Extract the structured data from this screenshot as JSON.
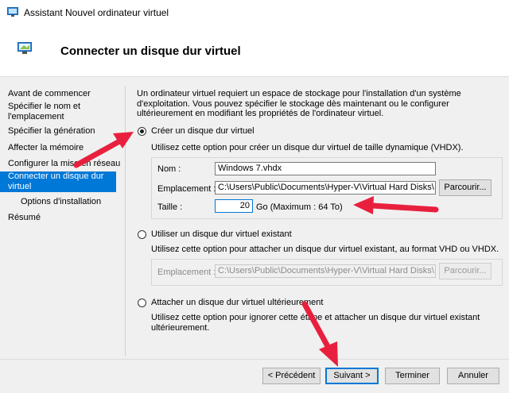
{
  "window": {
    "title": "Assistant Nouvel ordinateur virtuel"
  },
  "header": {
    "title": "Connecter un disque dur virtuel"
  },
  "nav": {
    "items": [
      {
        "label": "Avant de commencer"
      },
      {
        "label": "Spécifier le nom et l'emplacement"
      },
      {
        "label": "Spécifier la génération"
      },
      {
        "label": "Affecter la mémoire"
      },
      {
        "label": "Configurer la mise en réseau"
      },
      {
        "label": "Connecter un disque dur virtuel"
      },
      {
        "label": "Options d'installation"
      },
      {
        "label": "Résumé"
      }
    ],
    "active_index": 5
  },
  "intro": {
    "text": "Un ordinateur virtuel requiert un espace de stockage pour l'installation d'un système d'exploitation. Vous pouvez spécifier le stockage dès maintenant ou le configurer ultérieurement en modifiant les propriétés de l'ordinateur virtuel."
  },
  "option_create": {
    "label": "Créer un disque dur virtuel",
    "selected": true,
    "description": "Utilisez cette option pour créer un disque dur virtuel de taille dynamique (VHDX).",
    "name_label": "Nom :",
    "name_value": "Windows 7.vhdx",
    "location_label": "Emplacement :",
    "location_value": "C:\\Users\\Public\\Documents\\Hyper-V\\Virtual Hard Disks\\",
    "browse_label": "Parcourir...",
    "size_label": "Taille :",
    "size_value": "20",
    "size_unit": "Go (Maximum : 64 To)"
  },
  "option_existing": {
    "label": "Utiliser un disque dur virtuel existant",
    "selected": false,
    "description": "Utilisez cette option pour attacher un disque dur virtuel existant, au format VHD ou VHDX.",
    "location_label": "Emplacement :",
    "location_value": "C:\\Users\\Public\\Documents\\Hyper-V\\Virtual Hard Disks\\",
    "browse_label": "Parcourir..."
  },
  "option_later": {
    "label": "Attacher un disque dur virtuel ultérieurement",
    "selected": false,
    "description": "Utilisez cette option pour ignorer cette étape et attacher un disque dur virtuel existant ultérieurement."
  },
  "footer": {
    "prev_label": "< Précédent",
    "next_label": "Suivant >",
    "finish_label": "Terminer",
    "cancel_label": "Annuler"
  },
  "colors": {
    "accent": "#0078d7",
    "annotation_arrow": "#e8203e"
  }
}
